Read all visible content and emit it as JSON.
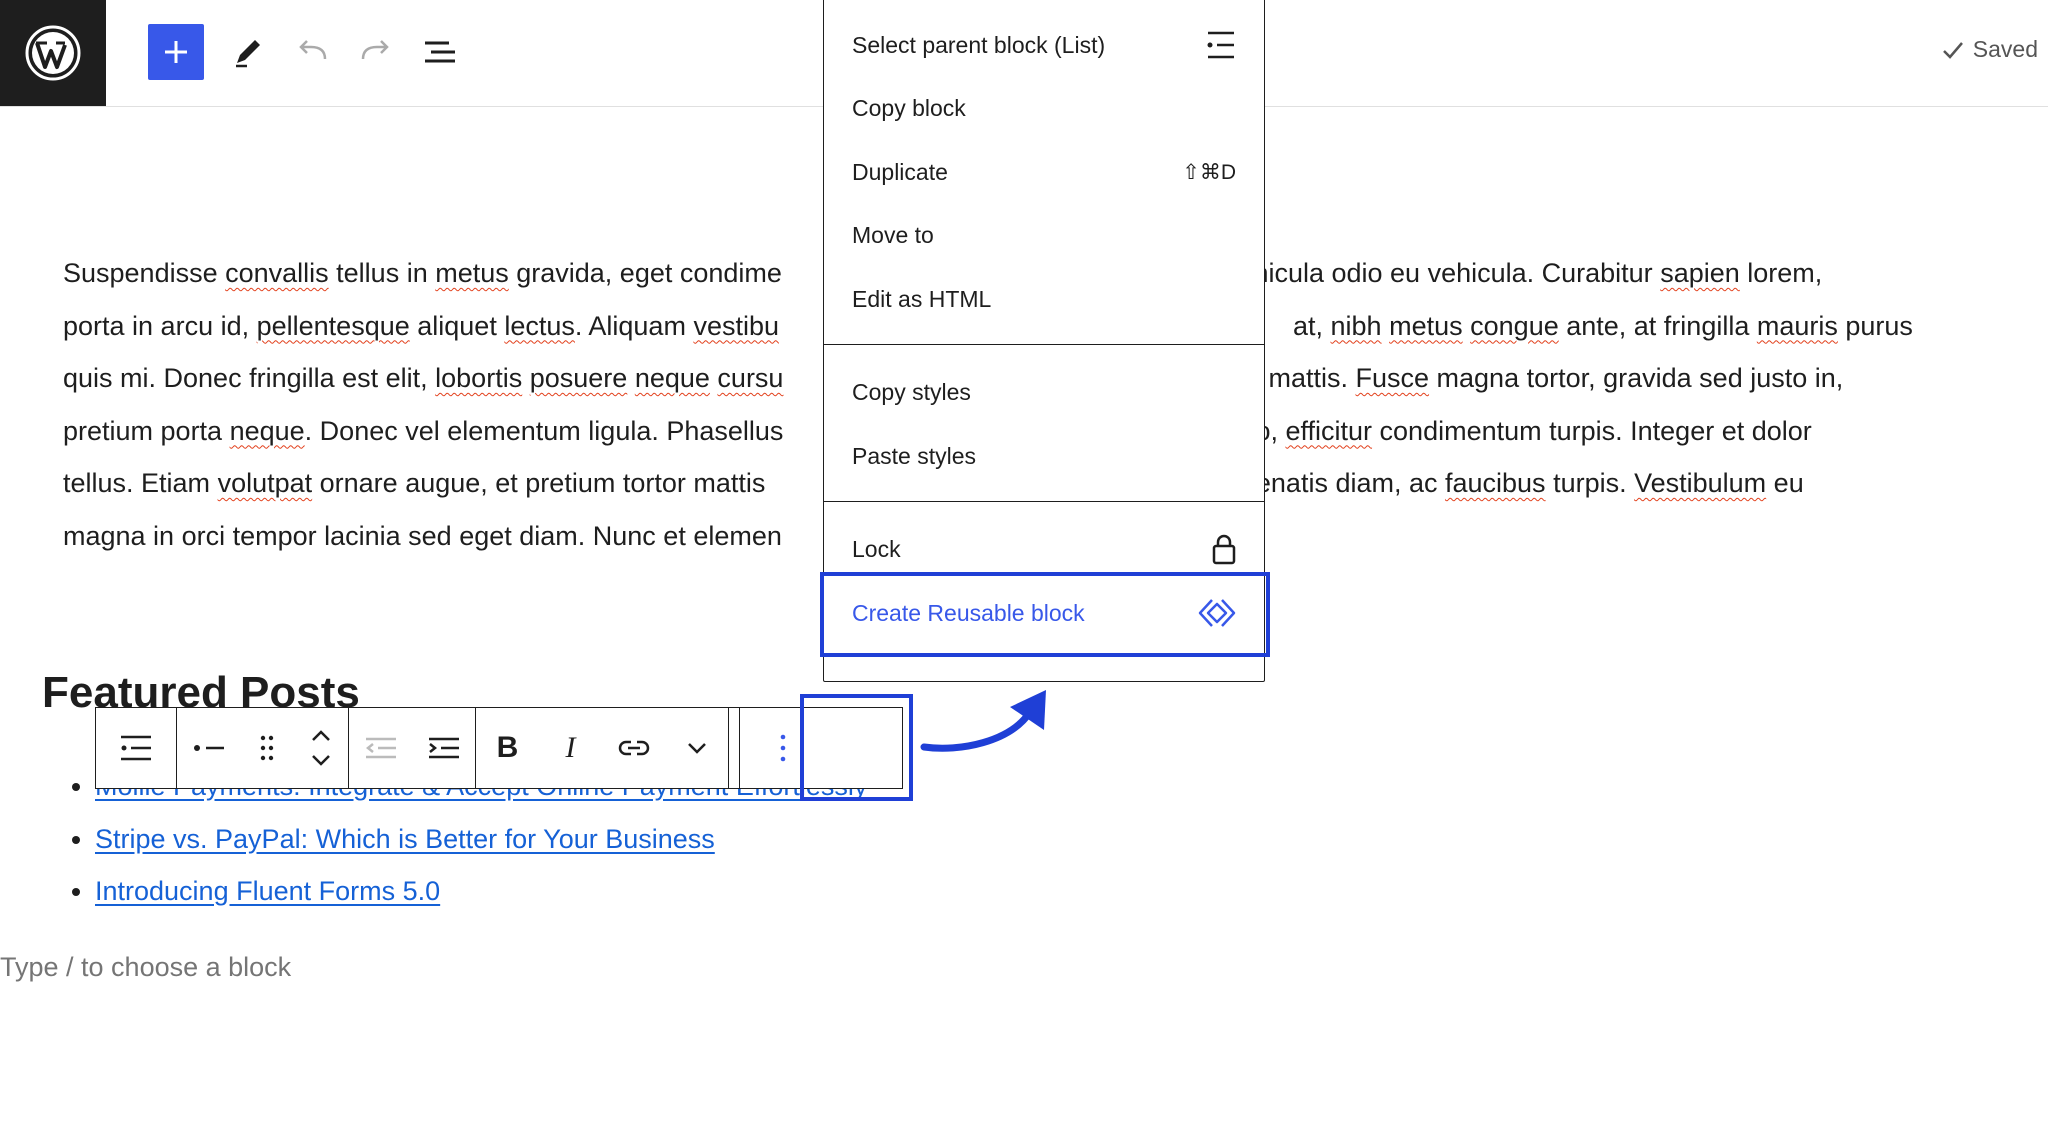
{
  "topbar": {
    "saved_label": "Saved",
    "icons": [
      "wordpress-icon",
      "plus-icon",
      "pencil-icon",
      "undo-icon",
      "redo-icon",
      "list-view-icon",
      "check-icon"
    ]
  },
  "content": {
    "paragraph_lines": [
      [
        {
          "t": "Suspendisse "
        },
        {
          "t": "convallis",
          "sq": true
        },
        {
          "t": " tellus in "
        },
        {
          "t": "metus",
          "sq": true
        },
        {
          "t": " gravida, eget condime"
        },
        {
          "t": " ",
          "gap": true
        },
        {
          "t": "vehicula odio eu vehicula. Curabitur "
        },
        {
          "t": "sapien",
          "sq": true
        },
        {
          "t": " lorem,"
        }
      ],
      [
        {
          "t": "porta in arcu id, "
        },
        {
          "t": "pellentesque",
          "sq": true
        },
        {
          "t": " aliquet "
        },
        {
          "t": "lectus",
          "sq": true
        },
        {
          "t": ". Aliquam "
        },
        {
          "t": "vestibu",
          "sq": true
        },
        {
          "t": " ",
          "gap": true
        },
        {
          "t": "at, "
        },
        {
          "t": "nibh",
          "sq": true
        },
        {
          "t": " "
        },
        {
          "t": "metus",
          "sq": true
        },
        {
          "t": " "
        },
        {
          "t": "congue",
          "sq": true
        },
        {
          "t": " ante, at fringilla "
        },
        {
          "t": "mauris",
          "sq": true
        },
        {
          "t": " purus"
        }
      ],
      [
        {
          "t": "quis mi. Donec fringilla est elit, "
        },
        {
          "t": "lobortis",
          "sq": true
        },
        {
          "t": " "
        },
        {
          "t": "posuere",
          "sq": true
        },
        {
          "t": " "
        },
        {
          "t": "neque",
          "sq": true
        },
        {
          "t": " "
        },
        {
          "t": "cursu",
          "sq": true
        },
        {
          "t": " ",
          "gap": true
        },
        {
          "t": "tae mattis. "
        },
        {
          "t": "Fusce",
          "sq": true
        },
        {
          "t": " magna tortor, gravida sed justo in,"
        }
      ],
      [
        {
          "t": "pretium porta "
        },
        {
          "t": "neque",
          "sq": true
        },
        {
          "t": ". Donec vel elementum ligula. Phasellus"
        },
        {
          "t": " ",
          "gap": true
        },
        {
          "t": "odio, "
        },
        {
          "t": "efficitur",
          "sq": true
        },
        {
          "t": " condimentum turpis. Integer et dolor"
        }
      ],
      [
        {
          "t": "tellus. Etiam "
        },
        {
          "t": "volutpat",
          "sq": true
        },
        {
          "t": " ornare augue, et pretium tortor mattis"
        },
        {
          "t": " ",
          "gap": true
        },
        {
          "t": "venenatis diam, ac "
        },
        {
          "t": "faucibus",
          "sq": true
        },
        {
          "t": " turpis. "
        },
        {
          "t": "Vestibulum",
          "sq": true
        },
        {
          "t": " eu"
        }
      ],
      [
        {
          "t": "magna in orci tempor lacinia sed eget diam. Nunc et elemen"
        }
      ]
    ],
    "heading": "Featured Posts",
    "posts": [
      "Mollie Payments: Integrate & Accept Online Payment Effortlessly",
      "Stripe vs. PayPal: Which is Better for Your Business",
      "Introducing Fluent Forms 5.0"
    ],
    "block_placeholder": "Type / to choose a block"
  },
  "block_toolbar": {
    "icons": [
      "parent-list-icon",
      "list-type-icon",
      "drag-handle-icon",
      "move-up-icon",
      "move-down-icon",
      "outdent-icon",
      "indent-icon",
      "bold-icon",
      "italic-icon",
      "link-icon",
      "more-formatting-chevron-icon",
      "options-kebab-icon"
    ],
    "bold_label": "B",
    "italic_label": "I"
  },
  "menu": {
    "items": [
      {
        "label": "Select parent block (List)",
        "icon": "list-icon"
      },
      {
        "label": "Copy block"
      },
      {
        "label": "Duplicate",
        "shortcut": "⇧⌘D"
      },
      {
        "label": "Move to"
      },
      {
        "label": "Edit as HTML"
      },
      {
        "label": "Copy styles"
      },
      {
        "label": "Paste styles"
      },
      {
        "label": "Lock",
        "icon": "lock-icon"
      },
      {
        "label": "Create Reusable block",
        "icon": "reusable-block-icon",
        "highlighted": true
      }
    ],
    "accent_color": "#3858e9",
    "highlight_color": "#1f3fd6"
  }
}
